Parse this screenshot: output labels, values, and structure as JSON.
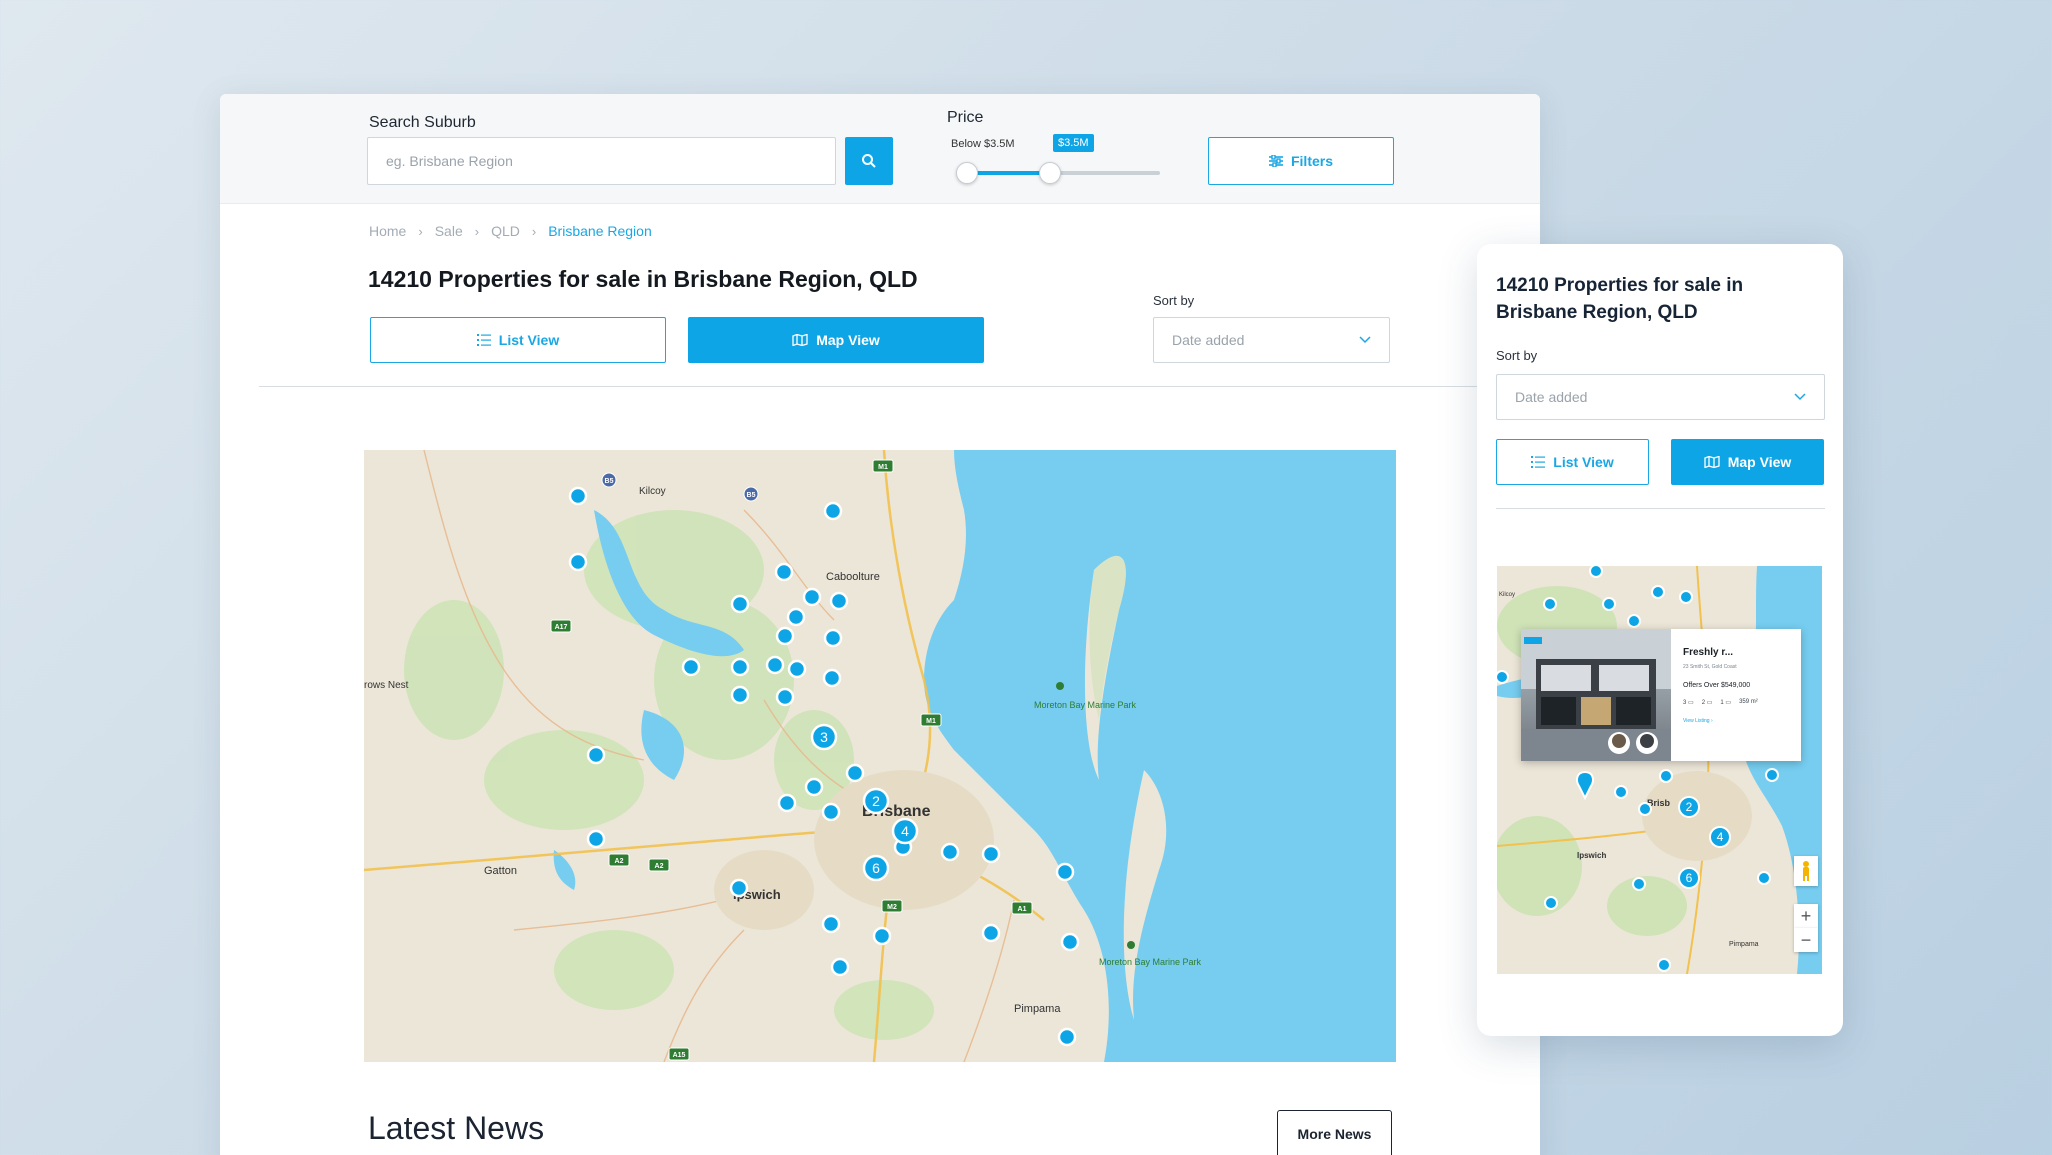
{
  "desktop": {
    "search": {
      "label": "Search Suburb",
      "placeholder": "eg. Brisbane Region"
    },
    "price": {
      "label": "Price",
      "below_label": "Below $3.5M",
      "tag": "$3.5M",
      "value_fraction": 0.45
    },
    "filters_label": "Filters",
    "breadcrumb": [
      "Home",
      "Sale",
      "QLD",
      "Brisbane Region"
    ],
    "title": "14210 Properties for sale in Brisbane Region, QLD",
    "list_view_label": "List View",
    "map_view_label": "Map View",
    "sort_label": "Sort by",
    "sort_value": "Date added",
    "map": {
      "places": [
        "Kilcoy",
        "Caboolture",
        "rows Nest",
        "Moreton Bay Marine Park",
        "Brisbane",
        "Gatton",
        "Ipswich",
        "Moreton Bay Marine Park",
        "Pimpama"
      ],
      "road_shields": [
        "M1",
        "B5",
        "B5",
        "A17",
        "M1",
        "A2",
        "A2",
        "M2",
        "A1",
        "A15"
      ],
      "clusters": [
        "3",
        "2",
        "4",
        "6"
      ]
    },
    "news_title": "Latest News",
    "more_news_label": "More News"
  },
  "mobile": {
    "title": "14210 Properties for sale in Brisbane Region, QLD",
    "sort_label": "Sort by",
    "sort_value": "Date added",
    "list_view_label": "List View",
    "map_view_label": "Map View",
    "card": {
      "title": "Freshly r...",
      "address": "23 Smith St, Gold Coast",
      "price": "Offers Over $549,000",
      "beds": "3",
      "baths": "2",
      "cars": "1",
      "area": "359 m²",
      "link": "View Listing"
    },
    "map": {
      "places": [
        "Kilcoy",
        "Brisb",
        "Ipswich",
        "Pimpama"
      ],
      "clusters": [
        "2",
        "4",
        "6"
      ]
    },
    "zoom_in": "+",
    "zoom_out": "−"
  },
  "colors": {
    "accent": "#0ea5e6",
    "sea": "#76cdf0",
    "land": "#ece6d8",
    "park": "#cfe3b7"
  }
}
